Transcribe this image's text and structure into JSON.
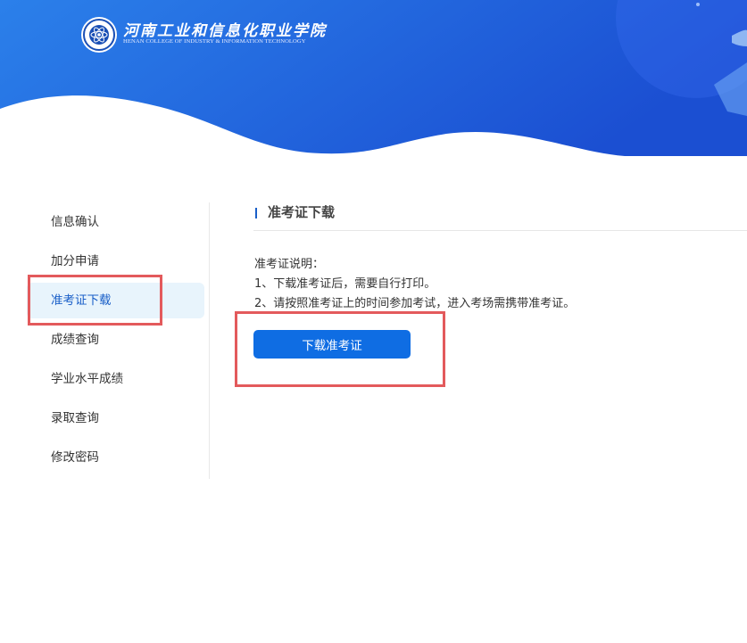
{
  "header": {
    "school_name_cn": "河南工业和信息化职业学院",
    "school_name_en": "HENAN COLLEGE OF INDUSTRY & INFORMATION TECHNOLOGY",
    "logo_icon": "school-emblem-icon",
    "colors": {
      "banner_start": "#2a7ee8",
      "banner_end": "#1a4fd0"
    }
  },
  "sidebar": {
    "items": [
      {
        "label": "信息确认"
      },
      {
        "label": "加分申请"
      },
      {
        "label": "准考证下载",
        "active": true
      },
      {
        "label": "成绩查询"
      },
      {
        "label": "学业水平成绩"
      },
      {
        "label": "录取查询"
      },
      {
        "label": "修改密码"
      }
    ]
  },
  "main": {
    "title": "准考证下载",
    "notes": {
      "heading": "准考证说明：",
      "lines": [
        "1、下载准考证后，需要自行打印。",
        "2、请按照准考证上的时间参加考试，进入考场需携带准考证。"
      ]
    },
    "download_button": "下载准考证"
  },
  "colors": {
    "accent": "#0f6de3",
    "active_bg": "#e8f4fc",
    "highlight_box": "#e35a5c"
  }
}
